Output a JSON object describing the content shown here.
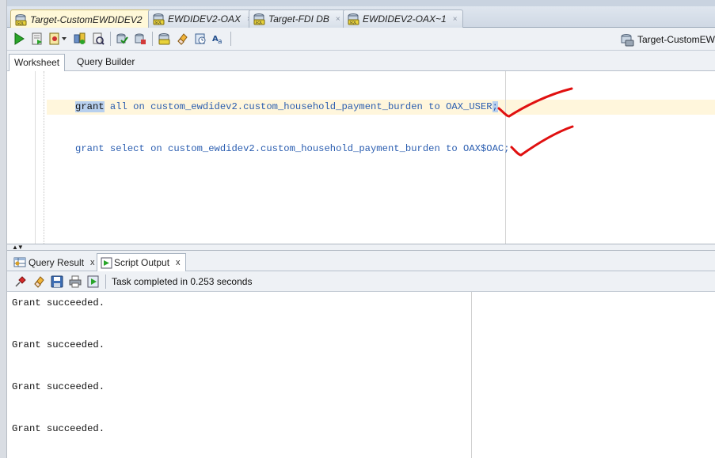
{
  "editor_tabs": [
    {
      "label": "Target-CustomEWDIDEV2",
      "active": true
    },
    {
      "label": "EWDIDEV2-OAX",
      "active": false
    },
    {
      "label": "Target-FDI DB",
      "active": false
    },
    {
      "label": "EWDIDEV2-OAX~1",
      "active": false
    }
  ],
  "tab_close": "×",
  "toolbar": {
    "connection_label": "Target-CustomEW"
  },
  "subtabs": {
    "worksheet": "Worksheet",
    "query_builder": "Query Builder"
  },
  "editor": {
    "line1": {
      "kw": "grant",
      "rest": " all on custom_ewdidev2.custom_household_payment_burden to OAX_USER",
      "semi": ";"
    },
    "line2": "grant select on custom_ewdidev2.custom_household_payment_burden to OAX$OAC;"
  },
  "output_tabs": {
    "query_result": "Query Result",
    "script_output": "Script Output",
    "close": "x"
  },
  "output_toolbar": {
    "status": "Task completed in 0.253 seconds"
  },
  "output_lines": [
    "Grant succeeded.",
    "Grant succeeded.",
    "Grant succeeded.",
    "Grant succeeded."
  ],
  "colors": {
    "accent": "#2a5db0",
    "current_line": "#fff6dc",
    "check_mark": "#e01010"
  }
}
